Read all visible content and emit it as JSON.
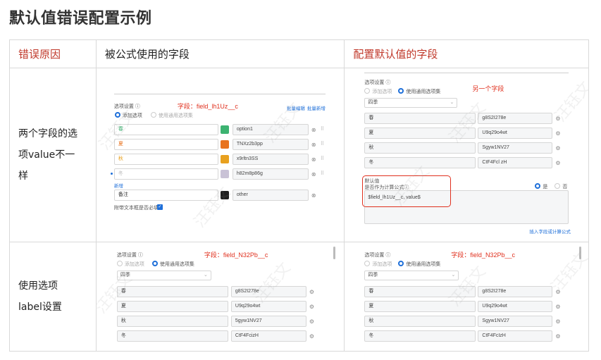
{
  "page_title": "默认值错误配置示例",
  "headers": {
    "reason": "错误原因",
    "formula_field": "被公式使用的字段",
    "default_field": "配置默认值的字段"
  },
  "rows": [
    {
      "reason_lines": [
        "两个字段的选",
        "项value不一",
        "样"
      ]
    },
    {
      "reason_lines": [
        "使用选项",
        "label设置"
      ]
    }
  ],
  "watermark": "汪钰文",
  "colors": {
    "accent_red": "#c0392b",
    "field_red": "#e0301e",
    "link_blue": "#1e6fd9"
  },
  "panel_a": {
    "section_label": "选项设置 ⓘ",
    "field_tag": "字段：field_lh1Uz__c",
    "radio_add": "添加选项",
    "radio_global": "使用通用选项集",
    "link_batch_edit": "批量编辑",
    "link_batch_add": "批量新增",
    "options": [
      {
        "label": "春",
        "value": "option1",
        "color": "#3cb371"
      },
      {
        "label": "夏",
        "value": "TNXz2b3pp",
        "color": "#e8731f"
      },
      {
        "label": "秋",
        "value": "x9rltn3SS",
        "color": "#e8a11f"
      },
      {
        "label": "冬",
        "value": "h82m8p86g",
        "color": "#c9c2d6"
      }
    ],
    "add_link": "新增",
    "other_label": "备注",
    "other_value": "other",
    "other_color": "#1f1f1f",
    "attach_text": "附带文本框是否必填"
  },
  "panel_b": {
    "section_label": "选项设置 ⓘ",
    "radio_add": "添加选项",
    "radio_global": "使用通用选项集",
    "another_field": "另一个字段",
    "select_value": "四季",
    "options": [
      {
        "label": "春",
        "value": "g8S2I278e"
      },
      {
        "label": "夏",
        "value": "U9q29o4wt"
      },
      {
        "label": "秋",
        "value": "Sgyw1NV27"
      },
      {
        "label": "冬",
        "value": "CtF4Fcl zH"
      }
    ],
    "default_label": "默认值",
    "default_question": "是否作为计算公式ⓘ",
    "yes": "是",
    "no": "否",
    "formula_text": "$field_lh1Uz__c, value$",
    "insert_link": "插入字段或计算公式"
  },
  "panel_c": {
    "section_label": "选项设置 ⓘ",
    "field_tag": "字段：field_N32Pb__c",
    "radio_add": "添加选项",
    "radio_global": "使用通用选项集",
    "select_value": "四季",
    "options": [
      {
        "label": "春",
        "value": "g8S2I278e"
      },
      {
        "label": "夏",
        "value": "U9q29o4wt"
      },
      {
        "label": "秋",
        "value": "5gyw1NV27"
      },
      {
        "label": "冬",
        "value": "CtF4FcizH"
      }
    ]
  },
  "panel_d": {
    "section_label": "选项设置 ⓘ",
    "field_tag": "字段：field_N32Pb__c",
    "radio_add": "添加选项",
    "radio_global": "使用通用选项集",
    "select_value": "四季",
    "options": [
      {
        "label": "春",
        "value": "g8S2I278e"
      },
      {
        "label": "夏",
        "value": "U9q29o4wt"
      },
      {
        "label": "秋",
        "value": "Sgyw1NV27"
      },
      {
        "label": "冬",
        "value": "CtF4FcIzH"
      }
    ]
  }
}
